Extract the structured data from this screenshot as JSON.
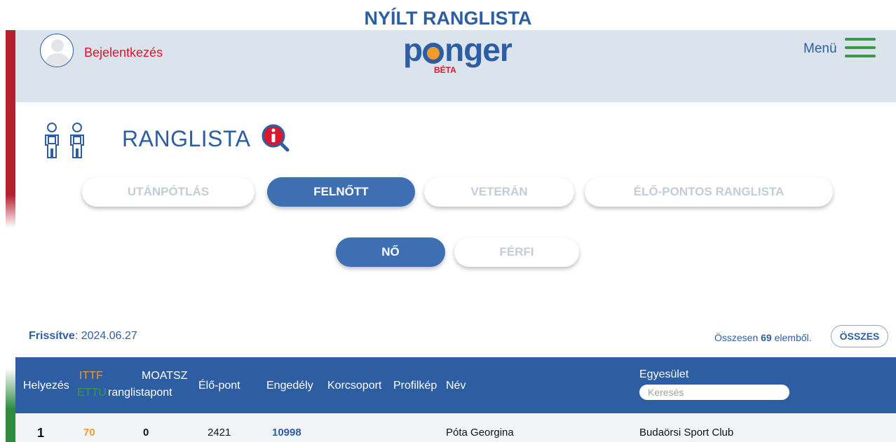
{
  "page_title": "NYÍLT RANGLISTA",
  "header": {
    "login_label": "Bejelentkezés",
    "logo_text": "ponger",
    "logo_beta": "BÉTA",
    "menu_label": "Menü"
  },
  "ranking": {
    "title": "RANGLISTA"
  },
  "category_tabs": [
    {
      "label": "UTÁNPÓTLÁS",
      "active": false
    },
    {
      "label": "FELNŐTT",
      "active": true
    },
    {
      "label": "VETERÁN",
      "active": false
    },
    {
      "label": "ÉLŐ-PONTOS RANGLISTA",
      "active": false
    }
  ],
  "gender_tabs": [
    {
      "label": "NŐ",
      "active": true
    },
    {
      "label": "FÉRFI",
      "active": false
    }
  ],
  "meta": {
    "updated_label": "Frissítve",
    "updated_value": ": 2024.06.27",
    "total_prefix": "Összesen ",
    "total_count": "69",
    "total_suffix": " elemből.",
    "all_button": "ÖSSZES"
  },
  "table": {
    "headers": {
      "helyezes": "Helyezés",
      "ittf": "ITTF",
      "ettu": "ETTU",
      "moatsz_line1": "MOATSZ",
      "moatsz_line2": "ranglistapont",
      "elo_pont": "Élő-pont",
      "engedely": "Engedély",
      "korcsoport": "Korcsoport",
      "profilkep": "Profilkép",
      "nev": "Név",
      "egyesulet": "Egyesület"
    },
    "search_placeholder": "Keresés",
    "rows": [
      {
        "helyezes": "1",
        "ittf": "70",
        "moatsz": "0",
        "elo_pont": "2421",
        "engedely": "10998",
        "korcsoport": "",
        "nev": "Póta Georgina",
        "egyesulet": "Budaörsi Sport Club"
      }
    ]
  },
  "colors": {
    "brand_blue": "#2d5ea3",
    "login_red": "#e8132a",
    "ittf_orange": "#f29a2e",
    "ettu_green": "#3a9a47",
    "menu_green": "#3a9a47"
  }
}
